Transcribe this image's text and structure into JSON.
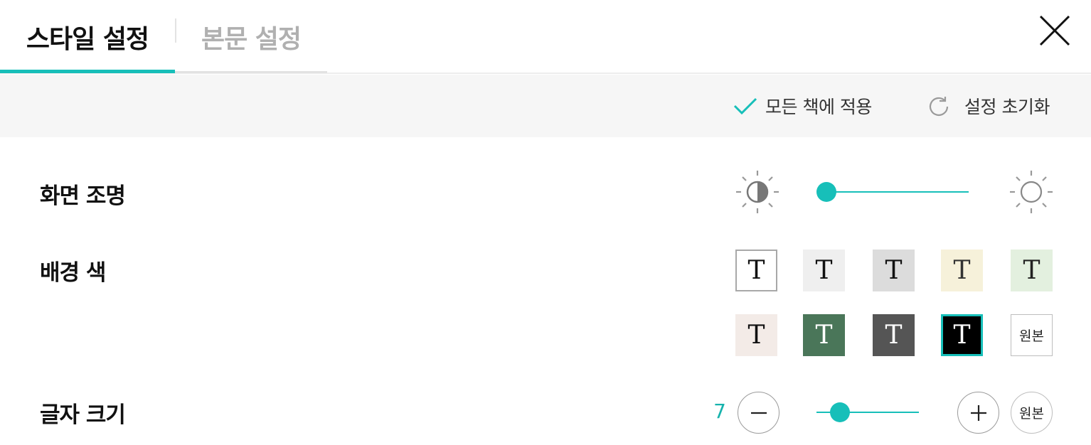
{
  "tabs": [
    {
      "label": "스타일 설정",
      "active": true
    },
    {
      "label": "본문 설정",
      "active": false
    }
  ],
  "actions": {
    "apply_all_label": "모든 책에 적용",
    "reset_label": "설정 초기화"
  },
  "brightness": {
    "label": "화면 조명",
    "value_fraction": 0.06
  },
  "background": {
    "label": "배경 색",
    "glyph": "T",
    "swatches": [
      {
        "bg": "#ffffff",
        "fg": "#111111",
        "border": "#a8a8a8",
        "selected": false
      },
      {
        "bg": "#efefef",
        "fg": "#111111",
        "border": "none",
        "selected": false
      },
      {
        "bg": "#dcdcdc",
        "fg": "#111111",
        "border": "none",
        "selected": false
      },
      {
        "bg": "#f6f1da",
        "fg": "#333333",
        "border": "none",
        "selected": false
      },
      {
        "bg": "#e3f0df",
        "fg": "#222222",
        "border": "none",
        "selected": false
      },
      {
        "bg": "#f3ebe7",
        "fg": "#111111",
        "border": "none",
        "selected": false
      },
      {
        "bg": "#4a7659",
        "fg": "#ffffff",
        "border": "none",
        "selected": false
      },
      {
        "bg": "#555555",
        "fg": "#ffffff",
        "border": "none",
        "selected": false
      },
      {
        "bg": "#000000",
        "fg": "#ffffff",
        "border": "#17bfb9",
        "selected": true
      }
    ],
    "original_label": "원본"
  },
  "font_size": {
    "label": "글자 크기",
    "value": "7",
    "value_fraction": 0.23,
    "original_label": "원본"
  },
  "colors": {
    "accent": "#17bfb9"
  }
}
